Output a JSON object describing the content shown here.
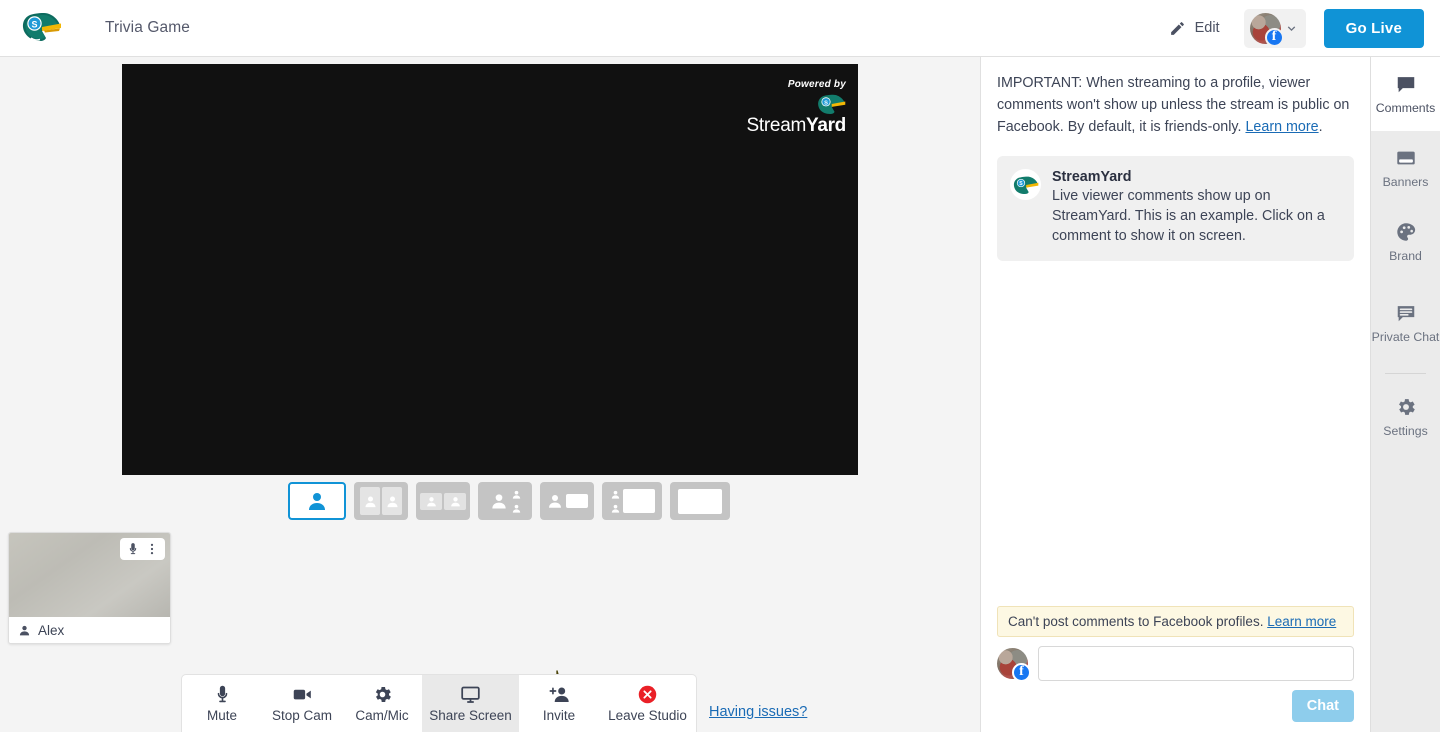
{
  "colors": {
    "accent_blue": "#1093d6",
    "link_blue": "#1a6bb5",
    "page_bg": "#f4f4f4",
    "rail_bg": "#ebebeb",
    "preview_bg": "#111111",
    "comment_card_bg": "#f0f0f0",
    "warn_bg": "#fdf8e3",
    "chat_btn_disabled": "#8ecdec",
    "facebook_blue": "#1877f2",
    "leave_red": "#ea2027",
    "arrow_yellow": "#f4d41c"
  },
  "topbar": {
    "logo_icon": "streamyard-duck-logo",
    "studio_title": "Trivia Game",
    "edit_label": "Edit",
    "edit_icon": "pencil-icon",
    "destination": {
      "avatar_icon": "user-avatar",
      "platform_badge": "facebook-icon",
      "platform_letter": "f",
      "chevron_icon": "chevron-down-icon"
    },
    "go_live_label": "Go Live"
  },
  "stage": {
    "preview": {
      "watermark_powered_by": "Powered by",
      "watermark_brand_part1": "Stream",
      "watermark_brand_part2": "Yard",
      "watermark_logo_icon": "streamyard-duck-logo"
    },
    "layouts": {
      "label": "layout-selector",
      "options": [
        {
          "name": "layout-solo",
          "selected": true
        },
        {
          "name": "layout-split-two",
          "selected": false
        },
        {
          "name": "layout-group-two",
          "selected": false
        },
        {
          "name": "layout-one-plus-two",
          "selected": false
        },
        {
          "name": "layout-person-and-screen",
          "selected": false
        },
        {
          "name": "layout-sidebar-and-screen",
          "selected": false
        },
        {
          "name": "layout-screen-only",
          "selected": false
        }
      ]
    },
    "participant": {
      "name": "Alex",
      "mic_icon": "microphone-icon",
      "menu_icon": "kebab-menu-icon",
      "name_icon": "person-icon"
    },
    "annotation": {
      "arrow_icon": "curved-arrow-icon",
      "points_to": "Share Screen"
    }
  },
  "toolbar": {
    "items": [
      {
        "label": "Mute",
        "icon": "microphone-icon",
        "hovered": false
      },
      {
        "label": "Stop Cam",
        "icon": "video-camera-icon",
        "hovered": false
      },
      {
        "label": "Cam/Mic",
        "icon": "gear-icon",
        "hovered": false
      },
      {
        "label": "Share Screen",
        "icon": "monitor-icon",
        "hovered": true
      },
      {
        "label": "Invite",
        "icon": "add-person-icon",
        "hovered": false
      },
      {
        "label": "Leave Studio",
        "icon": "red-x-circle-icon",
        "hovered": false
      }
    ],
    "having_issues_label": "Having issues?"
  },
  "comments_panel": {
    "notice": {
      "text": "IMPORTANT: When streaming to a profile, viewer comments won't show up unless the stream is public on Facebook. By default, it is friends-only. ",
      "link_label": "Learn more",
      "trailing": "."
    },
    "comment": {
      "author": "StreamYard",
      "avatar_icon": "streamyard-duck-logo",
      "text": "Live viewer comments show up on StreamYard. This is an example. Click on a comment to show it on screen."
    },
    "warning": {
      "text": "Can't post comments to Facebook profiles. ",
      "link_label": "Learn more"
    },
    "compose": {
      "avatar_icon": "user-avatar",
      "platform_badge": "facebook-icon",
      "platform_letter": "f",
      "input_value": "",
      "input_placeholder": "",
      "send_label": "Chat"
    }
  },
  "rail": {
    "items": [
      {
        "label": "Comments",
        "icon": "comment-bubble-icon",
        "active": true
      },
      {
        "label": "Banners",
        "icon": "banner-icon",
        "active": false
      },
      {
        "label": "Brand",
        "icon": "palette-icon",
        "active": false
      },
      {
        "label": "Private Chat",
        "icon": "chat-lines-icon",
        "active": false
      },
      {
        "label": "Settings",
        "icon": "gear-icon",
        "active": false
      }
    ]
  }
}
